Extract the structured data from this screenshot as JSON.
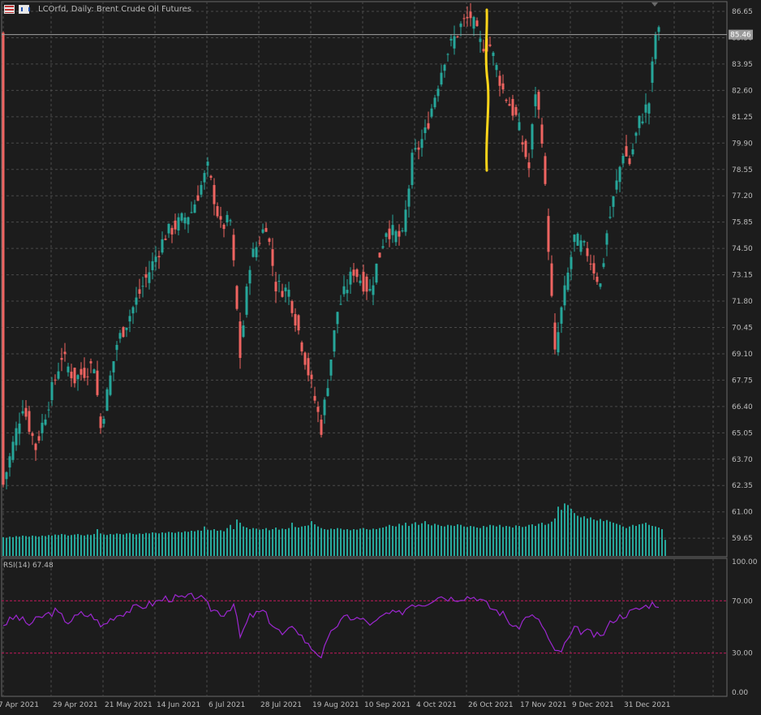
{
  "header": {
    "title": "LCOrfd, Daily:  Brent Crude Oil Futures",
    "indicator_label": "RSI(14) 67.48",
    "last_price_label": "85.46"
  },
  "colors": {
    "background": "#1c1c1c",
    "grid": "#4a4a4a",
    "bull": "#26a69a",
    "bear": "#ef6461",
    "volume": "#26a69a",
    "rsi_line": "#9c27d0",
    "rsi_levels": "#c2185b",
    "annotation": "#ffd51a",
    "axis_text": "#bcbcbc"
  },
  "chart_data": [
    {
      "type": "line",
      "subtype": "candlestick",
      "price_ticks": [
        "86.65",
        "85.30",
        "83.95",
        "82.60",
        "81.25",
        "79.90",
        "78.55",
        "77.20",
        "75.85",
        "74.50",
        "73.15",
        "71.80",
        "70.45",
        "69.10",
        "67.75",
        "66.40",
        "65.05",
        "63.70",
        "62.35",
        "61.00",
        "59.65"
      ],
      "ylim": [
        58.7,
        87.15
      ],
      "last_price": 85.46,
      "x_tick_labels": [
        "7 Apr 2021",
        "29 Apr 2021",
        "21 May 2021",
        "14 Jun 2021",
        "6 Jul 2021",
        "28 Jul 2021",
        "19 Aug 2021",
        "10 Sep 2021",
        "4 Oct 2021",
        "26 Oct 2021",
        "17 Nov 2021",
        "9 Dec 2021",
        "31 Dec 2021"
      ],
      "anchors": [
        [
          0,
          62.4
        ],
        [
          6,
          66.5
        ],
        [
          10,
          64.3
        ],
        [
          18,
          69.0
        ],
        [
          22,
          67.8
        ],
        [
          28,
          68.6
        ],
        [
          30,
          65.3
        ],
        [
          35,
          69.6
        ],
        [
          50,
          75.2
        ],
        [
          58,
          76.4
        ],
        [
          63,
          78.6
        ],
        [
          67,
          75.6
        ],
        [
          70,
          75.9
        ],
        [
          73,
          69.0
        ],
        [
          76,
          73.8
        ],
        [
          81,
          75.8
        ],
        [
          84,
          72.6
        ],
        [
          88,
          72.3
        ],
        [
          92,
          69.6
        ],
        [
          98,
          65.3
        ],
        [
          103,
          71.3
        ],
        [
          108,
          73.4
        ],
        [
          113,
          72.3
        ],
        [
          118,
          75.5
        ],
        [
          123,
          75.0
        ],
        [
          126,
          79.0
        ],
        [
          130,
          80.4
        ],
        [
          136,
          84.3
        ],
        [
          141,
          85.9
        ],
        [
          144,
          86.4
        ],
        [
          147,
          85.0
        ],
        [
          150,
          84.9
        ],
        [
          154,
          82.6
        ],
        [
          158,
          81.2
        ],
        [
          162,
          78.6
        ],
        [
          164,
          82.6
        ],
        [
          166,
          80.3
        ],
        [
          170,
          69.0
        ],
        [
          172,
          71.3
        ],
        [
          176,
          75.0
        ],
        [
          180,
          74.3
        ],
        [
          184,
          72.6
        ],
        [
          186,
          75.3
        ],
        [
          191,
          79.5
        ],
        [
          193,
          78.9
        ],
        [
          196,
          81.0
        ],
        [
          199,
          82.0
        ],
        [
          201,
          85.5
        ]
      ],
      "volume": [
        0.35,
        0.34,
        0.36,
        0.35,
        0.37,
        0.36,
        0.38,
        0.37,
        0.36,
        0.38,
        0.37,
        0.36,
        0.38,
        0.37,
        0.39,
        0.38,
        0.4,
        0.39,
        0.41,
        0.4,
        0.38,
        0.39,
        0.4,
        0.41,
        0.39,
        0.38,
        0.4,
        0.39,
        0.41,
        0.5,
        0.42,
        0.4,
        0.39,
        0.41,
        0.4,
        0.42,
        0.41,
        0.4,
        0.42,
        0.43,
        0.41,
        0.4,
        0.42,
        0.41,
        0.43,
        0.42,
        0.44,
        0.43,
        0.42,
        0.44,
        0.43,
        0.45,
        0.44,
        0.43,
        0.45,
        0.44,
        0.46,
        0.45,
        0.47,
        0.46,
        0.48,
        0.47,
        0.55,
        0.49,
        0.48,
        0.5,
        0.47,
        0.48,
        0.46,
        0.52,
        0.58,
        0.5,
        0.68,
        0.62,
        0.55,
        0.53,
        0.5,
        0.52,
        0.51,
        0.49,
        0.5,
        0.52,
        0.48,
        0.5,
        0.53,
        0.49,
        0.51,
        0.5,
        0.52,
        0.62,
        0.54,
        0.53,
        0.55,
        0.56,
        0.57,
        0.65,
        0.59,
        0.55,
        0.52,
        0.5,
        0.49,
        0.51,
        0.5,
        0.52,
        0.51,
        0.49,
        0.5,
        0.48,
        0.5,
        0.49,
        0.51,
        0.52,
        0.5,
        0.49,
        0.51,
        0.5,
        0.52,
        0.53,
        0.55,
        0.58,
        0.56,
        0.55,
        0.6,
        0.57,
        0.62,
        0.56,
        0.6,
        0.63,
        0.58,
        0.61,
        0.65,
        0.59,
        0.57,
        0.6,
        0.58,
        0.56,
        0.55,
        0.58,
        0.57,
        0.56,
        0.59,
        0.58,
        0.55,
        0.54,
        0.56,
        0.55,
        0.53,
        0.52,
        0.56,
        0.54,
        0.58,
        0.57,
        0.55,
        0.58,
        0.54,
        0.56,
        0.55,
        0.53,
        0.57,
        0.56,
        0.54,
        0.55,
        0.58,
        0.59,
        0.56,
        0.6,
        0.62,
        0.58,
        0.6,
        0.64,
        0.7,
        0.92,
        0.86,
        0.98,
        0.95,
        0.88,
        0.8,
        0.75,
        0.72,
        0.74,
        0.7,
        0.72,
        0.68,
        0.66,
        0.69,
        0.65,
        0.67,
        0.64,
        0.62,
        0.6,
        0.58,
        0.55,
        0.52,
        0.55,
        0.58,
        0.56,
        0.59,
        0.6,
        0.62,
        0.58,
        0.56,
        0.55,
        0.53,
        0.5,
        0.3
      ],
      "annotation": {
        "color_name": "yellow",
        "type": "vertical-stroke"
      }
    },
    {
      "type": "line",
      "name": "RSI(14)",
      "last_value": 67.48,
      "ticks": [
        "100.00",
        "70.00",
        "30.00",
        "0.00"
      ],
      "levels": [
        70,
        30
      ],
      "ylim": [
        0,
        100
      ],
      "anchors": [
        [
          0,
          52
        ],
        [
          4,
          58
        ],
        [
          8,
          52
        ],
        [
          12,
          58
        ],
        [
          16,
          62
        ],
        [
          20,
          54
        ],
        [
          24,
          60
        ],
        [
          28,
          58
        ],
        [
          30,
          50
        ],
        [
          34,
          58
        ],
        [
          40,
          64
        ],
        [
          46,
          68
        ],
        [
          50,
          72
        ],
        [
          56,
          72
        ],
        [
          60,
          74
        ],
        [
          64,
          64
        ],
        [
          68,
          60
        ],
        [
          71,
          68
        ],
        [
          73,
          42
        ],
        [
          76,
          58
        ],
        [
          80,
          62
        ],
        [
          83,
          52
        ],
        [
          86,
          44
        ],
        [
          90,
          50
        ],
        [
          94,
          36
        ],
        [
          98,
          28
        ],
        [
          102,
          50
        ],
        [
          106,
          58
        ],
        [
          110,
          56
        ],
        [
          114,
          52
        ],
        [
          118,
          60
        ],
        [
          122,
          60
        ],
        [
          126,
          68
        ],
        [
          130,
          68
        ],
        [
          134,
          74
        ],
        [
          138,
          72
        ],
        [
          142,
          73
        ],
        [
          146,
          73
        ],
        [
          150,
          65
        ],
        [
          154,
          60
        ],
        [
          158,
          48
        ],
        [
          162,
          60
        ],
        [
          166,
          52
        ],
        [
          170,
          30
        ],
        [
          172,
          32
        ],
        [
          176,
          48
        ],
        [
          180,
          46
        ],
        [
          184,
          42
        ],
        [
          188,
          56
        ],
        [
          192,
          60
        ],
        [
          196,
          64
        ],
        [
          200,
          68
        ],
        [
          202,
          67.5
        ]
      ]
    }
  ]
}
